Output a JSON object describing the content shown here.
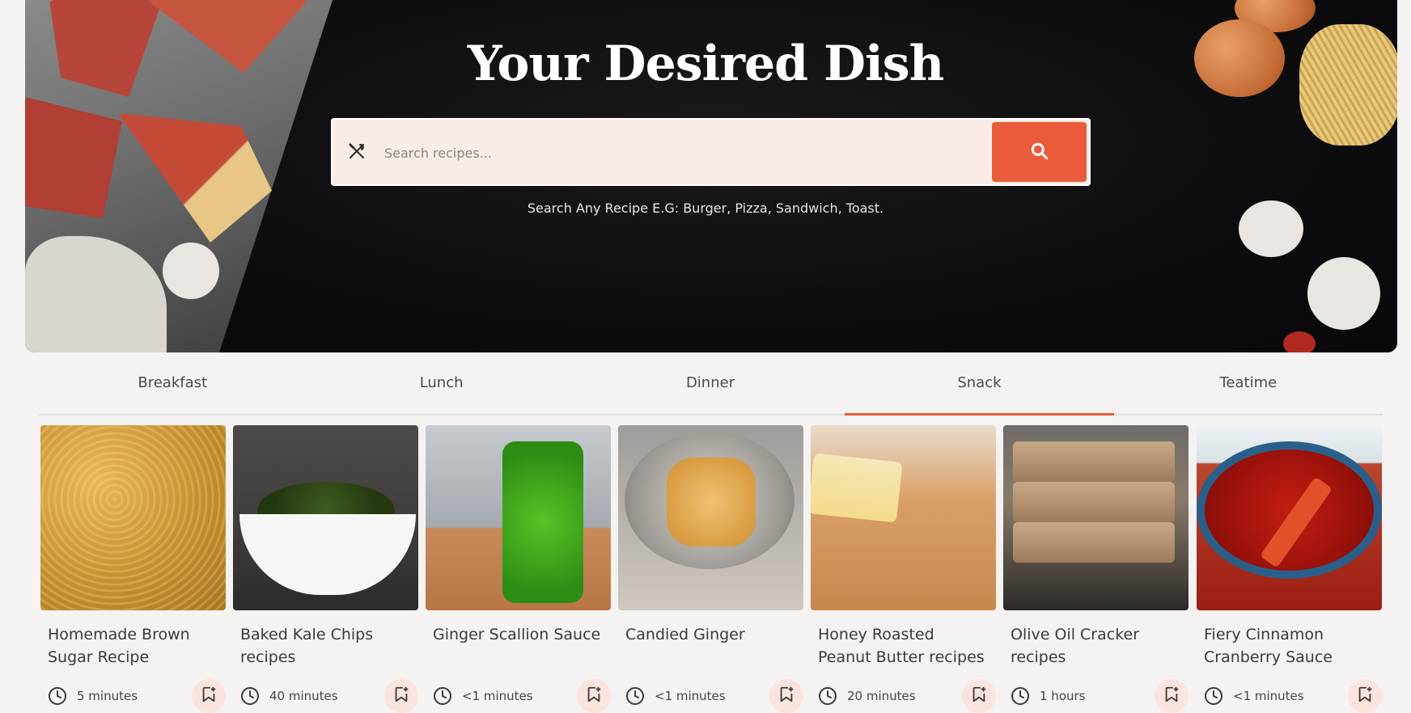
{
  "hero": {
    "title": "Your Desired Dish",
    "search_placeholder": "Search recipes...",
    "hint": "Search Any Recipe E.G: Burger, Pizza, Sandwich, Toast."
  },
  "tabs": [
    {
      "label": "Breakfast",
      "active": false
    },
    {
      "label": "Lunch",
      "active": false
    },
    {
      "label": "Dinner",
      "active": false
    },
    {
      "label": "Snack",
      "active": true
    },
    {
      "label": "Teatime",
      "active": false
    }
  ],
  "recipes": [
    {
      "title": "Homemade Brown Sugar Recipe",
      "time": "5 minutes",
      "image": "brown-sugar"
    },
    {
      "title": "Baked Kale Chips recipes",
      "time": "40 minutes",
      "image": "kale-chips"
    },
    {
      "title": "Ginger Scallion Sauce",
      "time": "<1 minutes",
      "image": "ginger-scallion-sauce"
    },
    {
      "title": "Candied Ginger",
      "time": "<1 minutes",
      "image": "candied-ginger"
    },
    {
      "title": "Honey Roasted Peanut Butter recipes",
      "time": "20 minutes",
      "image": "peanut-butter"
    },
    {
      "title": "Olive Oil Cracker recipes",
      "time": "1 hours",
      "image": "olive-oil-crackers"
    },
    {
      "title": "Fiery Cinnamon Cranberry Sauce",
      "time": "<1 minutes",
      "image": "cranberry-sauce"
    }
  ],
  "colors": {
    "accent": "#ea5b3a",
    "search_bg": "#f9ece7",
    "page_bg": "#f4f3f2",
    "bookmark_bg": "#fbe4dd"
  },
  "icons": {
    "search_field": "utensils-icon",
    "search_button": "search-icon",
    "time": "clock-icon",
    "save": "bookmark-add-icon"
  }
}
